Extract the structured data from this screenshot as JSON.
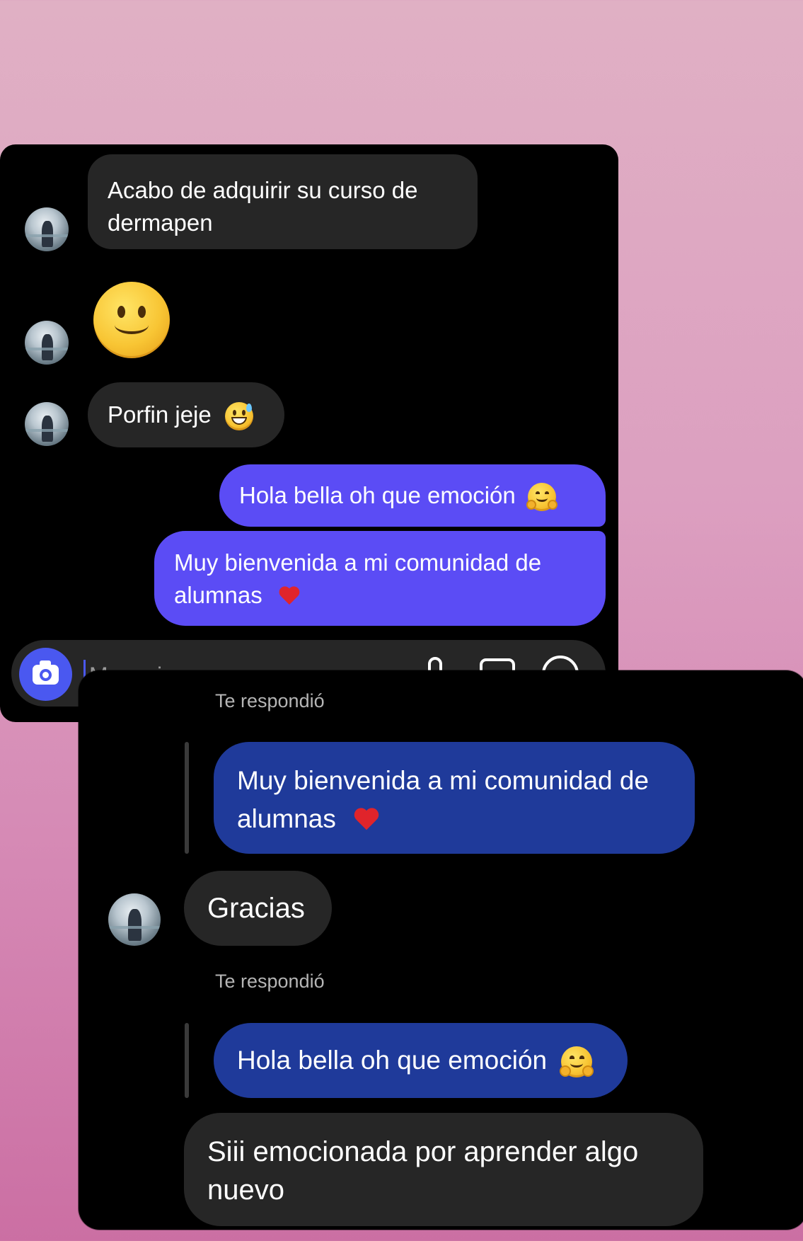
{
  "conversation_top": {
    "messages": [
      {
        "sender": "other",
        "line1": "Acabo de adquirir su curso de",
        "line2": "dermapen"
      },
      {
        "sender": "other",
        "emoji": "slightly-smiling-face"
      },
      {
        "sender": "other",
        "text": "Porfin jeje",
        "emoji": "grinning-sweat-face"
      },
      {
        "sender": "me",
        "text": "Hola bella oh que emoción",
        "emoji": "hugging-face"
      },
      {
        "sender": "me",
        "line1": "Muy bienvenida a mi comunidad de",
        "line2": "alumnas",
        "emoji": "red-heart"
      }
    ],
    "composer": {
      "camera_icon": "camera-icon",
      "placeholder_partial": "Mensaje...",
      "icons": [
        "microphone-icon",
        "image-icon",
        "add-icon"
      ]
    },
    "colors": {
      "incoming_bubble": "#262626",
      "outgoing_bubble": "#5b4cf5",
      "camera_button": "#4a58f0"
    }
  },
  "conversation_bottom": {
    "reply_1": {
      "label": "Te respondió",
      "quoted_line1": "Muy bienvenida a mi comunidad de",
      "quoted_line2": "alumnas",
      "quoted_emoji": "red-heart"
    },
    "message_1": {
      "text": "Gracias"
    },
    "reply_2": {
      "label": "Te respondió",
      "quoted_text": "Hola bella oh que emoción",
      "quoted_emoji": "hugging-face"
    },
    "message_2": {
      "line1": "Siii emocionada por aprender algo",
      "line2": "nuevo"
    },
    "colors": {
      "quoted_bubble": "#1f3a9a",
      "incoming_bubble": "#262626"
    }
  }
}
